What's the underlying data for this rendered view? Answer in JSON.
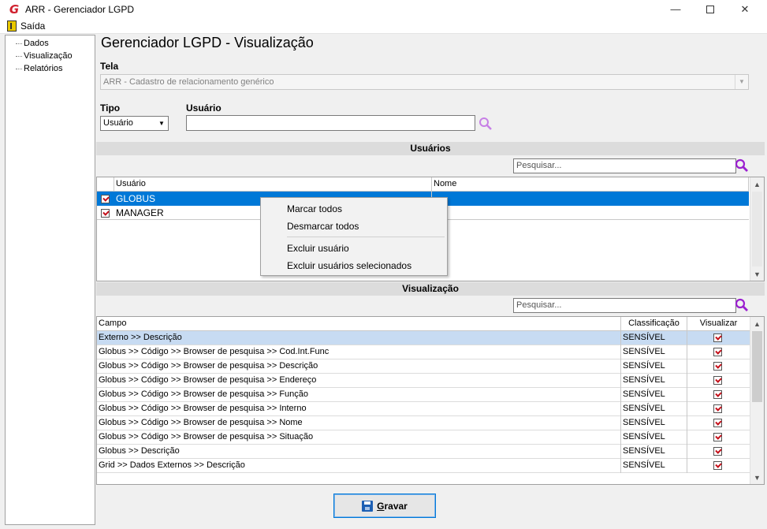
{
  "window": {
    "title": "ARR - Gerenciador LGPD",
    "logo_letter": "G",
    "minimize": "—",
    "close": "✕"
  },
  "menu": {
    "exit_label": "Saída"
  },
  "tree": {
    "items": [
      "Dados",
      "Visualização",
      "Relatórios"
    ]
  },
  "main": {
    "page_title": "Gerenciador LGPD - Visualização",
    "tela_label": "Tela",
    "tela_value": "ARR - Cadastro de relacionamento genérico",
    "tipo_label": "Tipo",
    "tipo_value": "Usuário",
    "usuario_label": "Usuário",
    "usuario_value": ""
  },
  "users_section": {
    "title": "Usuários",
    "search_placeholder": "Pesquisar...",
    "columns": [
      "Usuário",
      "Nome"
    ],
    "rows": [
      {
        "usuario": "GLOBUS",
        "nome": "",
        "checked": true,
        "selected": true
      },
      {
        "usuario": "MANAGER",
        "nome": "",
        "checked": true,
        "selected": false
      }
    ]
  },
  "context_menu": {
    "items": [
      "Marcar todos",
      "Desmarcar todos",
      "Excluir usuário",
      "Excluir usuários selecionados"
    ]
  },
  "fields_section": {
    "title": "Visualização",
    "search_placeholder": "Pesquisar...",
    "columns": [
      "Campo",
      "Classificação",
      "Visualizar"
    ],
    "rows": [
      {
        "campo": "Externo >> Descrição",
        "classificacao": "SENSÍVEL",
        "visualizar": true,
        "selected": true
      },
      {
        "campo": "Globus >> Código >> Browser de pesquisa >> Cod.Int.Func",
        "classificacao": "SENSÍVEL",
        "visualizar": true
      },
      {
        "campo": "Globus >> Código >> Browser de pesquisa >> Descrição",
        "classificacao": "SENSÍVEL",
        "visualizar": true
      },
      {
        "campo": "Globus >> Código >> Browser de pesquisa >> Endereço",
        "classificacao": "SENSÍVEL",
        "visualizar": true
      },
      {
        "campo": "Globus >> Código >> Browser de pesquisa >> Função",
        "classificacao": "SENSÍVEL",
        "visualizar": true
      },
      {
        "campo": "Globus >> Código >> Browser de pesquisa >> Interno",
        "classificacao": "SENSÍVEL",
        "visualizar": true
      },
      {
        "campo": "Globus >> Código >> Browser de pesquisa >> Nome",
        "classificacao": "SENSÍVEL",
        "visualizar": true
      },
      {
        "campo": "Globus >> Código >> Browser de pesquisa >> Situação",
        "classificacao": "SENSÍVEL",
        "visualizar": true
      },
      {
        "campo": "Globus >> Descrição",
        "classificacao": "SENSÍVEL",
        "visualizar": true
      },
      {
        "campo": "Grid >> Dados Externos >>  Descrição",
        "classificacao": "SENSÍVEL",
        "visualizar": true
      }
    ]
  },
  "save_button": {
    "label_first": "G",
    "label_rest": "ravar"
  },
  "colors": {
    "selection": "#0078d7",
    "row_highlight": "#c7dbf2",
    "search_icon": "#9b1fd0",
    "check": "#c4101a"
  }
}
